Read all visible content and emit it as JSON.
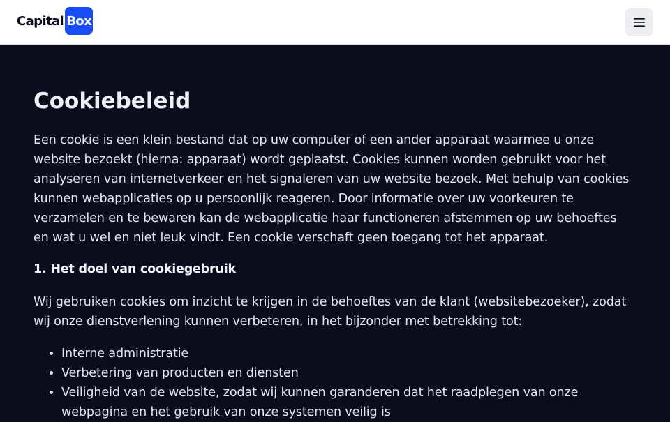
{
  "header": {
    "logo_text_1": "Capital",
    "logo_text_2": "Box",
    "menu_icon": "hamburger-menu-icon",
    "brand_color": "#1a4cf5"
  },
  "main": {
    "title": "Cookiebeleid",
    "intro": "Een cookie is een klein bestand dat op uw computer of een ander apparaat waarmee u onze website bezoekt (hierna: apparaat) wordt geplaatst. Cookies kunnen worden gebruikt voor het analyseren van internetverkeer en het signaleren van uw website bezoek. Met behulp van cookies kunnen webapplicaties op u persoonlijk reageren. Door informatie over uw voorkeuren te verzamelen en te bewaren kan de webapplicatie haar functioneren afstemmen op uw behoeftes en wat u wel en niet leuk vindt. Een cookie verschaft geen toegang tot het apparaat.",
    "section_heading": "1. Het doel van cookiegebruik",
    "section_text": "Wij gebruiken cookies om inzicht te krijgen in de behoeftes van de klant (websitebezoeker), zodat wij onze dienstverlening kunnen verbeteren, in het bijzonder met betrekking tot:",
    "purposes": [
      "Interne administratie",
      "Verbetering van producten en diensten",
      "Veiligheid van de website, zodat wij kunnen garanderen dat het raadplegen van onze webpagina en het gebruik van onze systemen veilig is"
    ]
  }
}
